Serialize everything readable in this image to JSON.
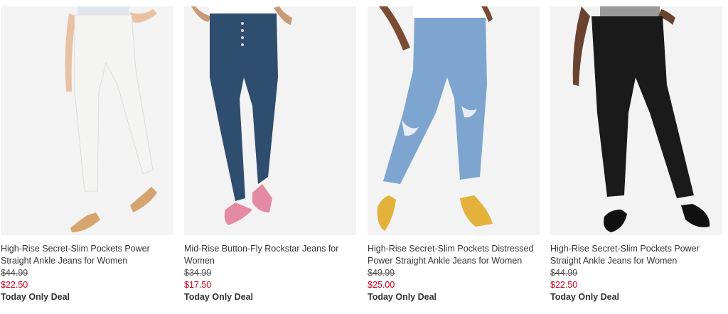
{
  "products": [
    {
      "name": "High-Rise Secret-Slim Pockets Power Straight Ankle Jeans for Women",
      "was_price": "$44.99",
      "sale_price": "$22.50",
      "deal": "Today Only Deal",
      "jean_color": "#f4f4f2",
      "shoe_color": "#d6a56f"
    },
    {
      "name": "Mid-Rise Button-Fly Rockstar Jeans for Women",
      "was_price": "$34.99",
      "sale_price": "$17.50",
      "deal": "Today Only Deal",
      "jean_color": "#2f4d6e",
      "shoe_color": "#e48aa5"
    },
    {
      "name": "High-Rise Secret-Slim Pockets Distressed Power Straight Ankle Jeans for Women",
      "was_price": "$49.99",
      "sale_price": "$25.00",
      "deal": "Today Only Deal",
      "jean_color": "#7ea5cf",
      "shoe_color": "#e4b23a"
    },
    {
      "name": "High-Rise Secret-Slim Pockets Power Straight Ankle Jeans for Women",
      "was_price": "$44.99",
      "sale_price": "$22.50",
      "deal": "Today Only Deal",
      "jean_color": "#1a1a1a",
      "shoe_color": "#111111"
    }
  ]
}
